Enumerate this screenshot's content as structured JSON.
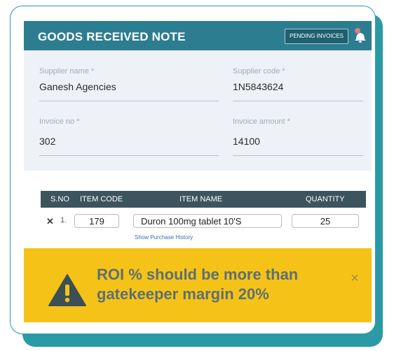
{
  "header": {
    "title": "GOODS RECEIVED NOTE",
    "pending_button": "PENDING INVOICES"
  },
  "form": {
    "supplier_name": {
      "label": "Supplier name *",
      "value": "Ganesh Agencies"
    },
    "supplier_code": {
      "label": "Supplier code *",
      "value": "1N5843624"
    },
    "invoice_no": {
      "label": "Invoice no *",
      "value": "302"
    },
    "invoice_amount": {
      "label": "Invoice amount *",
      "value": "14100"
    }
  },
  "table": {
    "headers": [
      "S.NO",
      "ITEM CODE",
      "ITEM NAME",
      "QUANTITY"
    ],
    "rows": [
      {
        "sno": "1.",
        "item_code": "179",
        "item_name": "Duron 100mg tablet 10'S",
        "quantity": "25"
      }
    ],
    "history_link": "Show Purchase History"
  },
  "alert": {
    "message": "ROI % should be more than gatekeeper margin 20%",
    "close_symbol": "×"
  },
  "colors": {
    "header_bg": "#2d7d90",
    "alert_bg": "#f5c318",
    "accent": "#2a9aa6"
  },
  "icons": [
    "bell-icon",
    "warning-icon",
    "close-icon",
    "remove-row-icon"
  ]
}
